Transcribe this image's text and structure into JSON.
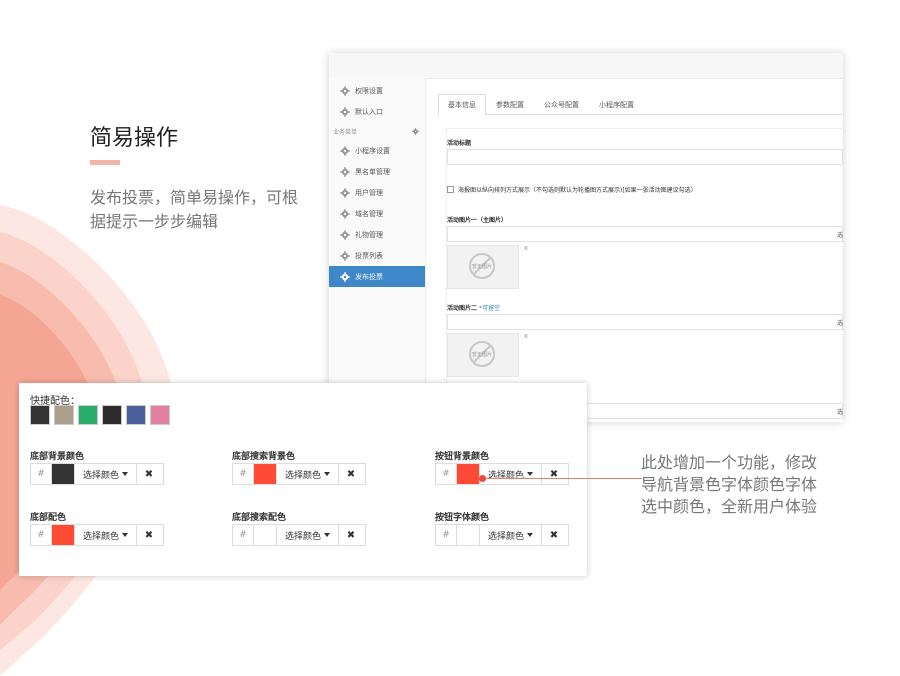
{
  "slide": {
    "title": "简易操作",
    "description": "发布投票，简单易操作，可根据提示一步步编辑",
    "note": "此处增加一个功能，修改导航背景色字体颜色字体选中颜色，全新用户体验"
  },
  "admin": {
    "sidebar": {
      "items_top": [
        {
          "label": "权限设置",
          "icon": "gear-icon"
        },
        {
          "label": "默认入口",
          "icon": "gear-icon"
        }
      ],
      "group_label": "业务菜单",
      "items": [
        {
          "label": "小程序设置",
          "icon": "gear-icon"
        },
        {
          "label": "黑名单管理",
          "icon": "gear-icon"
        },
        {
          "label": "用户管理",
          "icon": "gear-icon"
        },
        {
          "label": "域名管理",
          "icon": "gear-icon"
        },
        {
          "label": "礼物管理",
          "icon": "gear-icon"
        },
        {
          "label": "投票列表",
          "icon": "gear-icon"
        },
        {
          "label": "发布投票",
          "icon": "gear-icon",
          "active": true
        }
      ]
    },
    "tabs": [
      "基本信息",
      "参数配置",
      "公众号配置",
      "小程序配置"
    ],
    "form": {
      "activity_title_label": "活动标题",
      "checkbox_label": "海报图以纵向排列方式展示（不勾选则默认为轮播图方式展示)[如果一张活动图建议勾选）",
      "image1_label": "活动图片一（主图片）",
      "image2_label": "活动图片二",
      "image2_optional": "*可留空",
      "select_label": "选",
      "no_image_text": "暂无图片",
      "close_mark": "x"
    }
  },
  "colors": {
    "quick_label": "快捷配色：",
    "quick_swatches": [
      "#333333",
      "#ab9e8b",
      "#2aac6b",
      "#2b2b2b",
      "#4a5f9c",
      "#e07f9e"
    ],
    "hash": "#",
    "pick_label": "选择颜色",
    "clear_symbol": "✖",
    "fields": [
      {
        "label": "底部背景颜色",
        "color": "#333333"
      },
      {
        "label": "底部搜索背景色",
        "color": "#ff4a35"
      },
      {
        "label": "按钮背景颜色",
        "color": "#ff4a35"
      },
      {
        "label": "底部配色",
        "color": "#ff4a35"
      },
      {
        "label": "底部搜索配色",
        "color": "#ffffff"
      },
      {
        "label": "按钮字体颜色",
        "color": "#ffffff"
      }
    ]
  }
}
